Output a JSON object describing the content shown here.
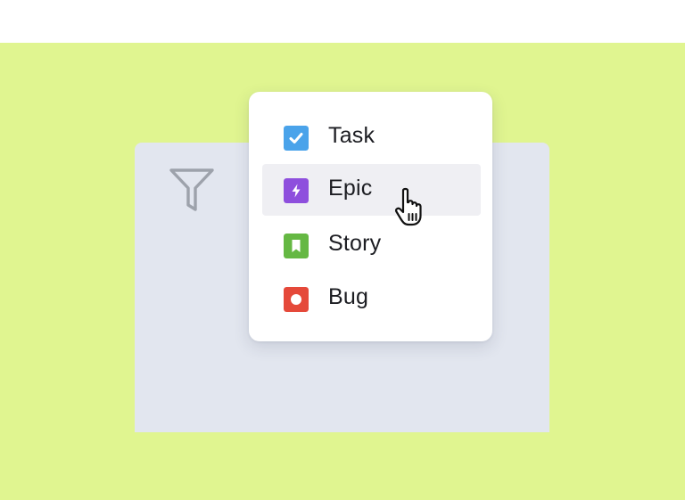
{
  "filter": {
    "icon": "filter-icon"
  },
  "issue_type_menu": {
    "items": [
      {
        "label": "Task",
        "icon": "task-checkbox-icon",
        "color": "#4aa3ea",
        "selected": true,
        "hovered": false
      },
      {
        "label": "Epic",
        "icon": "epic-lightning-icon",
        "color": "#8e4fdd",
        "selected": false,
        "hovered": true
      },
      {
        "label": "Story",
        "icon": "story-bookmark-icon",
        "color": "#65b843",
        "selected": false,
        "hovered": false
      },
      {
        "label": "Bug",
        "icon": "bug-circle-icon",
        "color": "#e5493a",
        "selected": false,
        "hovered": false
      }
    ]
  },
  "colors": {
    "backdrop": "#e0f590",
    "panel": "#e2e6ef",
    "hover": "#efeff3"
  },
  "cursor": {
    "icon": "hand-pointer-cursor-icon"
  }
}
